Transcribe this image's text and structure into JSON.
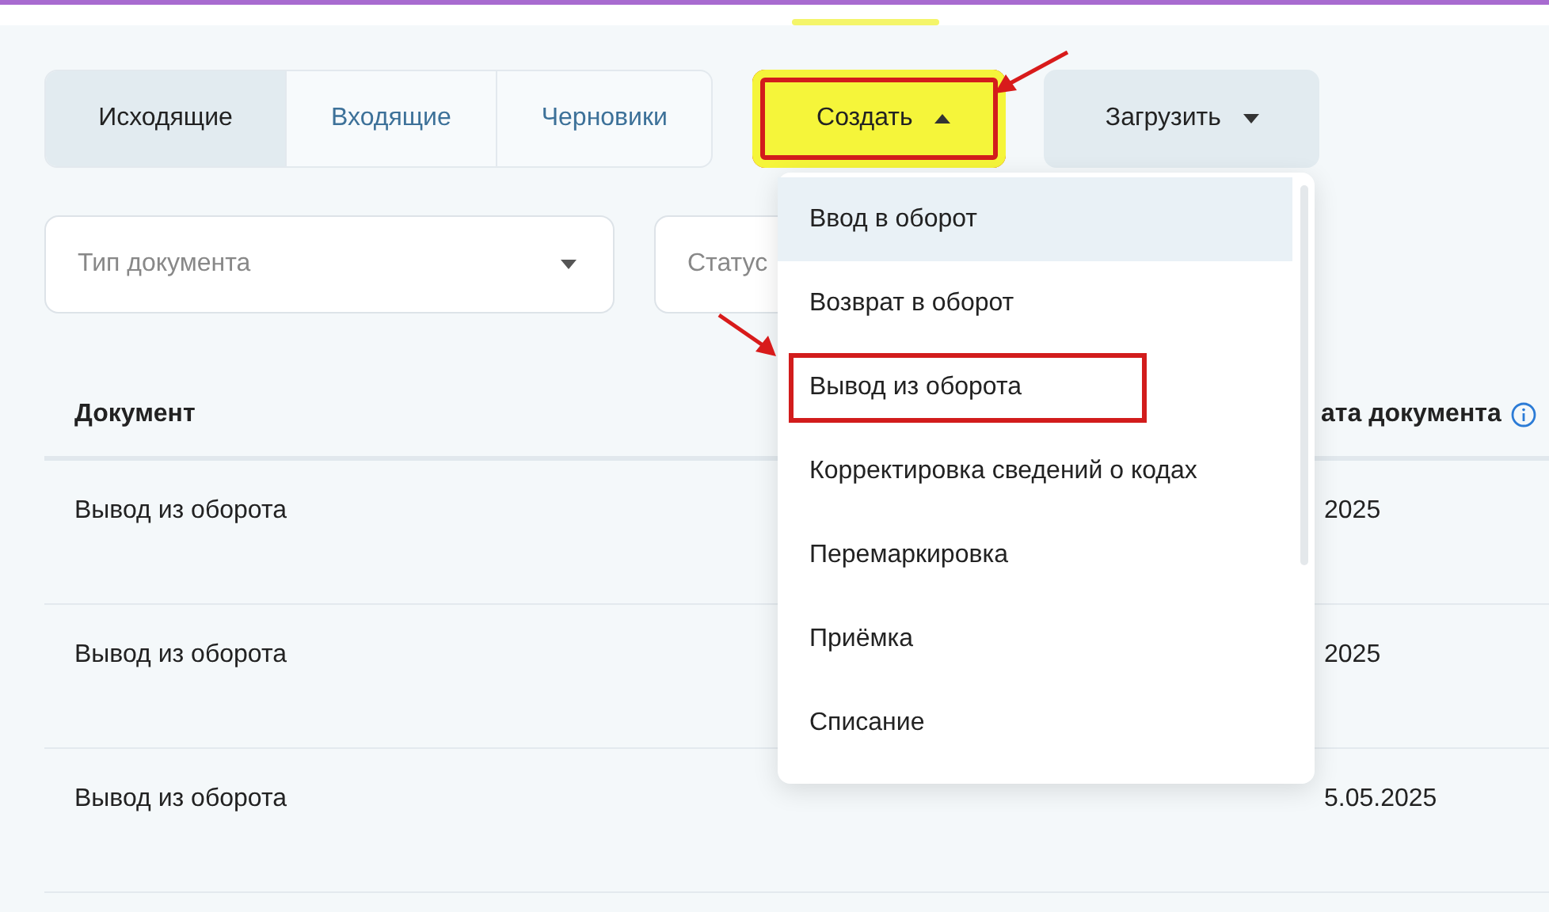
{
  "tabs": [
    {
      "label": "Исходящие",
      "selected": true
    },
    {
      "label": "Входящие",
      "selected": false
    },
    {
      "label": "Черновики",
      "selected": false
    }
  ],
  "create_button": {
    "label": "Создать",
    "expanded": true,
    "annotated": true
  },
  "upload_button": {
    "label": "Загрузить",
    "expanded": false
  },
  "filters": [
    {
      "placeholder": "Тип документа"
    },
    {
      "placeholder": "Статус"
    }
  ],
  "table": {
    "columns": [
      "Документ",
      "ата документа"
    ],
    "rows": [
      [
        "Вывод из оборота",
        "2025"
      ],
      [
        "Вывод из оборота",
        "2025"
      ],
      [
        "Вывод из оборота",
        "5.05.2025"
      ]
    ]
  },
  "dropdown": {
    "items": [
      {
        "label": "Ввод в оборот",
        "selected": true,
        "annotated": false
      },
      {
        "label": "Возврат в оборот",
        "selected": false,
        "annotated": false
      },
      {
        "label": "Вывод из оборота",
        "selected": false,
        "annotated": true
      },
      {
        "label": "Корректировка сведений о кодах",
        "selected": false,
        "annotated": false
      },
      {
        "label": "Перемаркировка",
        "selected": false,
        "annotated": false
      },
      {
        "label": "Приёмка",
        "selected": false,
        "annotated": false
      },
      {
        "label": "Списание",
        "selected": false,
        "annotated": false
      }
    ]
  }
}
